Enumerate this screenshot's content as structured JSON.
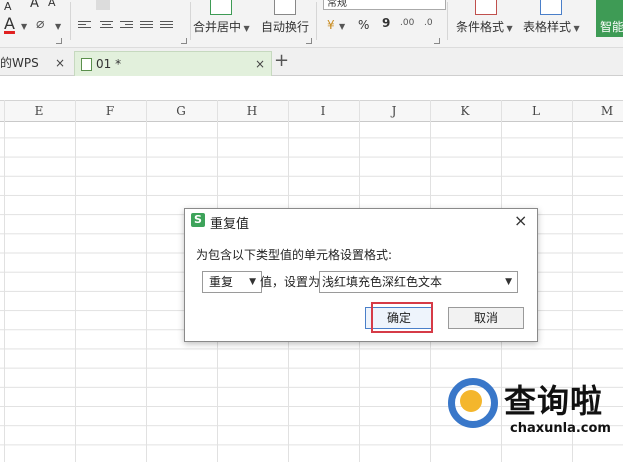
{
  "ribbon": {
    "font_color_label": "A",
    "font_sizes": [
      "A",
      "A"
    ],
    "merge_center": "合并居中",
    "auto_wrap": "自动换行",
    "number_format": "常规",
    "percent": "%",
    "comma": "9",
    "conditional_format": "条件格式",
    "table_style": "表格样式",
    "smart": "智能"
  },
  "tabs": [
    {
      "label": "我的WPS",
      "close": "×"
    },
    {
      "label": "01 *",
      "close": "×"
    }
  ],
  "add_tab": "+",
  "columns": [
    "E",
    "F",
    "G",
    "H",
    "I",
    "J",
    "K",
    "L",
    "M"
  ],
  "dialog": {
    "title": "重复值",
    "close": "×",
    "prompt": "为包含以下类型值的单元格设置格式:",
    "type_value": "重复",
    "mid_label": "值，设置为",
    "format_value": "浅红填充色深红色文本",
    "ok": "确定",
    "cancel": "取消"
  },
  "watermark": {
    "main": "查询啦",
    "sub": "chaxunla.com"
  },
  "colors": {
    "accent_green": "#3e9b55",
    "highlight_red": "#d63b47",
    "watermark_blue": "#3977c9",
    "watermark_yellow": "#f4b62c"
  }
}
